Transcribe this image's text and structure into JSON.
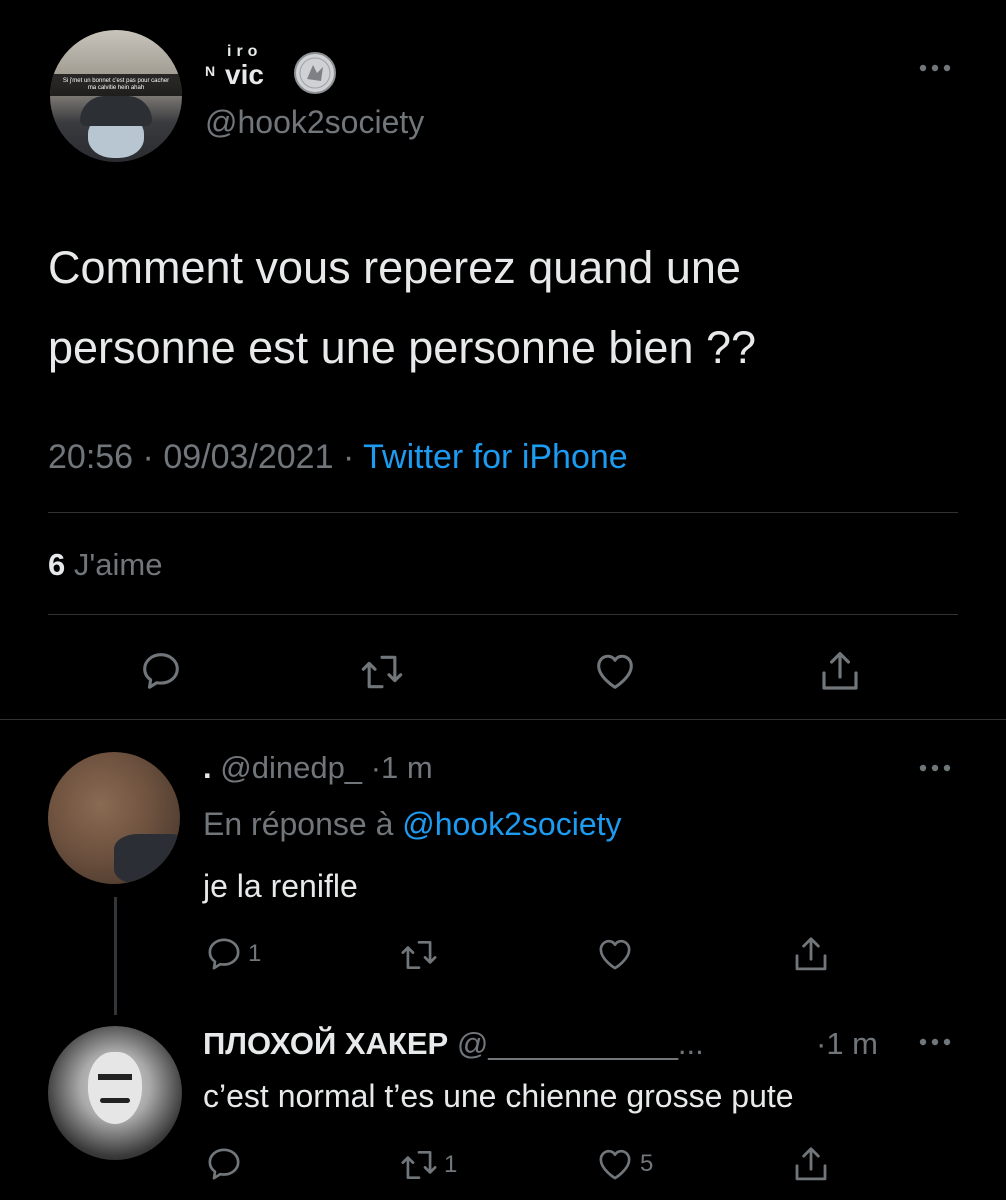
{
  "main_tweet": {
    "display_name_top": "iro",
    "display_name_main": "vic",
    "display_name_prefix": "N",
    "handle": "@hook2society",
    "avatar_caption": "Si j'met un bonnet c'est pas pour cacher ma calvitie hein ahah",
    "text_line1": "Comment vous reperez quand une",
    "text_line2": "personne est une personne bien ??",
    "time": "20:56",
    "date": "09/03/2021",
    "sep": "·",
    "source": "Twitter for iPhone",
    "likes_count": "6",
    "likes_label": "J'aime"
  },
  "reply1": {
    "name": ".",
    "handle": "@dinedp_",
    "time": "1 m",
    "sep": "·",
    "reply_prefix": "En réponse à",
    "reply_to": "@hook2society",
    "text": "je la renifle",
    "reply_count": "1"
  },
  "reply2": {
    "name": "ПЛОХОЙ ХАКЕР",
    "handle": "@___________...",
    "time": "1 m",
    "sep": "·",
    "text": "c’est normal t’es une chienne grosse pute",
    "retweet_count": "1",
    "like_count": "5"
  },
  "icons": {
    "more": "more-dots-icon",
    "reply": "reply-icon",
    "retweet": "retweet-icon",
    "like": "heart-icon",
    "share": "share-icon",
    "badge": "coin-badge-icon"
  },
  "colors": {
    "background": "#000000",
    "text": "#e7e9ea",
    "muted": "#71767b",
    "link": "#1d9bf0"
  }
}
